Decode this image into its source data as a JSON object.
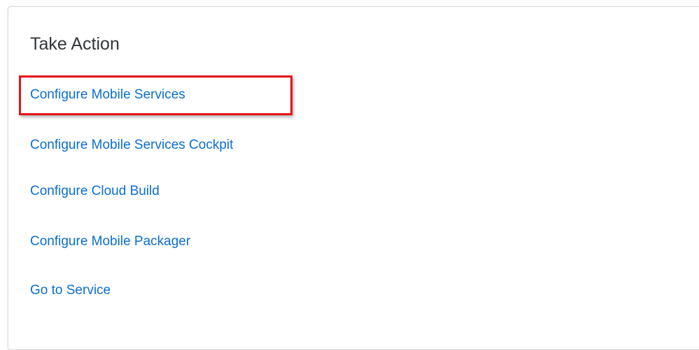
{
  "card": {
    "title": "Take Action",
    "links": [
      {
        "label": "Configure Mobile Services"
      },
      {
        "label": "Configure Mobile Services Cockpit"
      },
      {
        "label": "Configure Cloud Build"
      },
      {
        "label": "Configure Mobile Packager"
      },
      {
        "label": "Go to Service"
      }
    ]
  },
  "colors": {
    "link": "#0a6ed1",
    "title": "#32363a",
    "highlight_border": "#e3151a",
    "panel_border": "#d9d9d9"
  }
}
